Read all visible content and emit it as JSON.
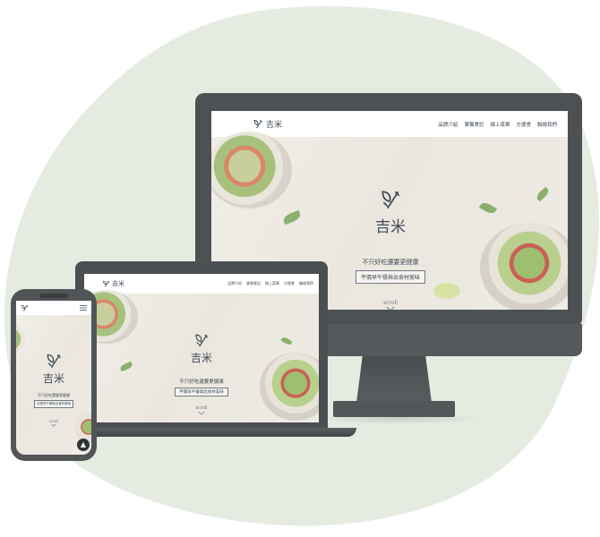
{
  "brand": "吉米",
  "nav": {
    "items": [
      "品牌介紹",
      "饕饕食記",
      "線上菜單",
      "方便食",
      "聯絡我們"
    ]
  },
  "hero": {
    "tagline": "不只好吃還要更健康",
    "button_label": "平價早午餐與出食材美味",
    "scroll_label": "scroll"
  },
  "colors": {
    "blob": "#e5ebe1",
    "device": "#4d5154",
    "text": "#3e4a55"
  },
  "icons": {
    "logo": "fork-leaf-icon",
    "menu": "hamburger-icon",
    "scroll": "chevron-down-icon",
    "back_to_top": "arrow-up-icon"
  }
}
